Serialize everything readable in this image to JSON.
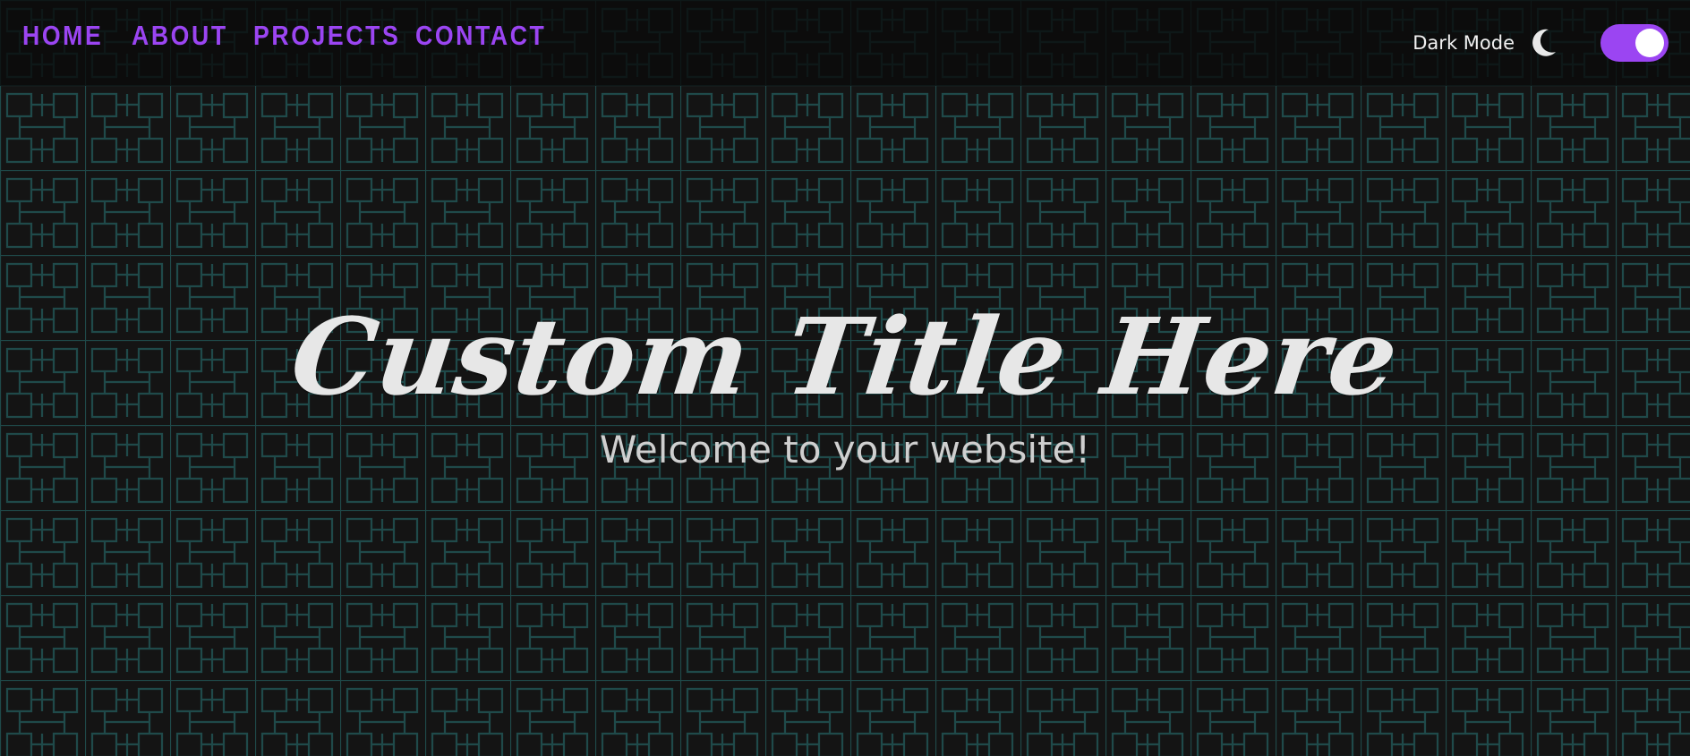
{
  "nav": {
    "links": [
      "HOME",
      "ABOUT",
      "PROJECTS",
      "CONTACT"
    ]
  },
  "mode": {
    "label": "Dark Mode",
    "icon": "moon-icon",
    "enabled": true
  },
  "hero": {
    "title": "Custom Title Here",
    "subtitle": "Welcome to your website!"
  },
  "colors": {
    "background": "#141414",
    "accent": "#9b45f2",
    "pattern": "#1f4a4a",
    "title": "#e7e7e7",
    "subtitle": "#cfcfcf"
  }
}
